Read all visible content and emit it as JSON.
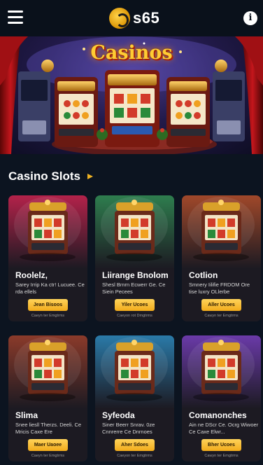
{
  "header": {
    "logo_text": "s65",
    "menu_icon": "hamburger-menu-icon",
    "info_icon": "info-icon",
    "info_glyph": "i"
  },
  "hero": {
    "title": "Casinos"
  },
  "section": {
    "title": "Casino Slots",
    "arrow_icon": "chevron-right-icon"
  },
  "colors": {
    "background": "#0c1420",
    "accent": "#f0b323",
    "button": "#f2ab1b"
  },
  "cards": [
    {
      "title": "Roolelz,",
      "desc": "Sarey Irrip Ka ctr! Lucuee. Ce rda ellels",
      "button": "Jean Bisoos",
      "note": "Caeyn ter Emgtrms",
      "accent": "#b3224a"
    },
    {
      "title": "Liirange Bnolom",
      "desc": "Shesl Brnrn Ecwerr Ge. Ce Siein Pecees",
      "button": "Yiler Ucoes",
      "note": "Caeyon rot Dmgtrms",
      "accent": "#2e7d4e"
    },
    {
      "title": "Cotlion",
      "desc": "Smnery Iilifie FRDOM Ore tise luxry OLlerbe",
      "button": "Aller Ucoes",
      "note": "Cawyn ter Emgtrms",
      "accent": "#a0482a"
    },
    {
      "title": "Slima",
      "desc": "Snee liesll Therzs. Deeli. Ce Mricis Caxe Ere",
      "button": "Maer Uaoee",
      "note": "Caeyn ter Emgtrms",
      "accent": "#8a3a2a"
    },
    {
      "title": "Syfeoda",
      "desc": "Siner Beerr Snrav. 0ze Cnnrerre Ce Dnrnoes",
      "button": "Aher Sdoes",
      "note": "Caeyon ter Emgtrms",
      "accent": "#2a7aa8"
    },
    {
      "title": "Comanonches",
      "desc": "Ain ne DScr Ce. Ocrg Wiwoer Ce Caxe Elwr...",
      "button": "Bher Ucoes",
      "note": "Cawyn ter Emgtrms",
      "accent": "#6a3aa8"
    }
  ]
}
